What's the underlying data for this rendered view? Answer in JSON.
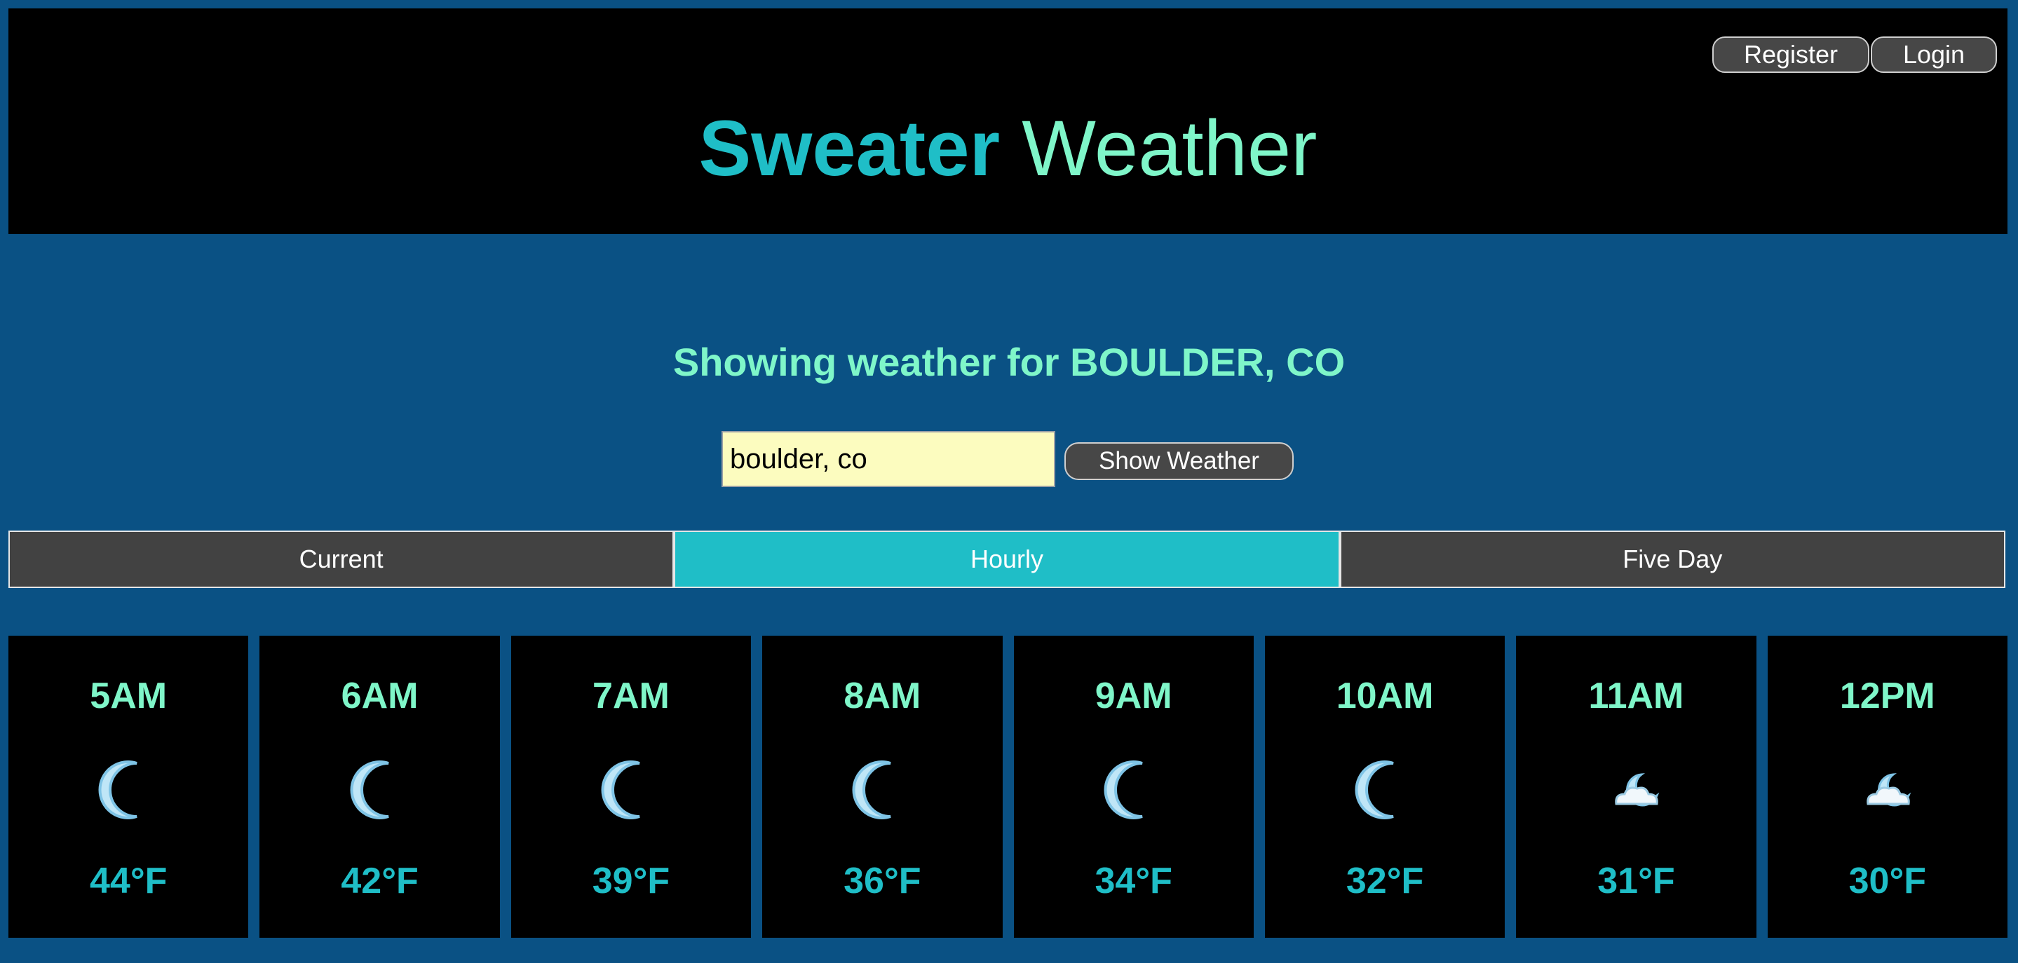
{
  "header": {
    "brand_strong": "Sweater",
    "brand_light": "Weather",
    "register_label": "Register",
    "login_label": "Login"
  },
  "main": {
    "showing_text": "Showing weather for BOULDER, CO",
    "search_value": "boulder, co",
    "show_button_label": "Show Weather"
  },
  "tabs": [
    {
      "label": "Current",
      "active": false
    },
    {
      "label": "Hourly",
      "active": true
    },
    {
      "label": "Five Day",
      "active": false
    }
  ],
  "hourly": [
    {
      "time": "5AM",
      "icon": "moon-icon",
      "temp": "44°F"
    },
    {
      "time": "6AM",
      "icon": "moon-icon",
      "temp": "42°F"
    },
    {
      "time": "7AM",
      "icon": "moon-icon",
      "temp": "39°F"
    },
    {
      "time": "8AM",
      "icon": "moon-icon",
      "temp": "36°F"
    },
    {
      "time": "9AM",
      "icon": "moon-icon",
      "temp": "34°F"
    },
    {
      "time": "10AM",
      "icon": "moon-icon",
      "temp": "32°F"
    },
    {
      "time": "11AM",
      "icon": "partly-cloudy-night-icon",
      "temp": "31°F"
    },
    {
      "time": "12PM",
      "icon": "partly-cloudy-night-icon",
      "temp": "30°F"
    }
  ],
  "colors": {
    "background": "#0a5184",
    "accent": "#1fbec7",
    "mint": "#7ff6c9"
  }
}
